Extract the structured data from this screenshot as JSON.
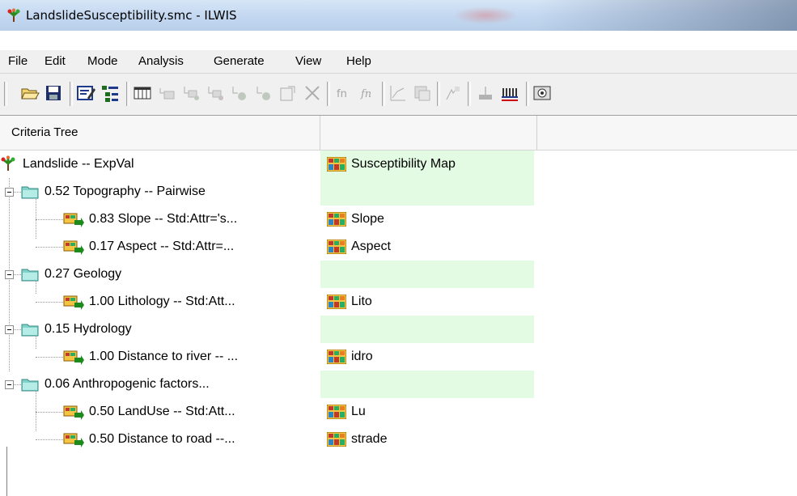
{
  "window": {
    "title": "LandslideSusceptibility.smc - ILWIS"
  },
  "menu": [
    "File",
    "Edit",
    "Mode",
    "Analysis",
    "Generate",
    "View",
    "Help"
  ],
  "toolbar_icons": [
    "open-icon",
    "save-icon",
    "edit-mode-icon",
    "tree-mode-icon",
    "table-icon",
    "add-group-icon",
    "add-factor-icon",
    "add-constraint-icon",
    "insert-icon",
    "insert-after-icon",
    "properties-icon",
    "delete-icon",
    "fn-icon",
    "fn-standardize-icon",
    "chart-icon",
    "generate-map-icon",
    "weights-icon",
    "score-icon",
    "histogram-icon",
    "show-icon"
  ],
  "columns": {
    "criteria_tree": "Criteria Tree",
    "col2": "",
    "col3": ""
  },
  "rows": [
    {
      "kind": "root",
      "label": "Landslide -- ExpVal",
      "map": "Susceptibility Map"
    },
    {
      "kind": "group",
      "label": "0.52 Topography -- Pairwise",
      "map": ""
    },
    {
      "kind": "factor",
      "label": "0.83 Slope -- Std:Attr='s...",
      "map": "Slope"
    },
    {
      "kind": "factor",
      "label": "0.17 Aspect -- Std:Attr=...",
      "map": "Aspect"
    },
    {
      "kind": "group",
      "label": "0.27 Geology",
      "map": ""
    },
    {
      "kind": "factor",
      "label": "1.00 Lithology -- Std:Att...",
      "map": "Lito"
    },
    {
      "kind": "group",
      "label": "0.15 Hydrology",
      "map": ""
    },
    {
      "kind": "factor",
      "label": "1.00 Distance to river -- ...",
      "map": "idro"
    },
    {
      "kind": "group",
      "label": "0.06 Anthropogenic factors...",
      "map": ""
    },
    {
      "kind": "factor",
      "label": "0.50 LandUse -- Std:Att...",
      "map": "Lu"
    },
    {
      "kind": "factor",
      "label": "0.50 Distance to road --...",
      "map": "strade"
    }
  ]
}
